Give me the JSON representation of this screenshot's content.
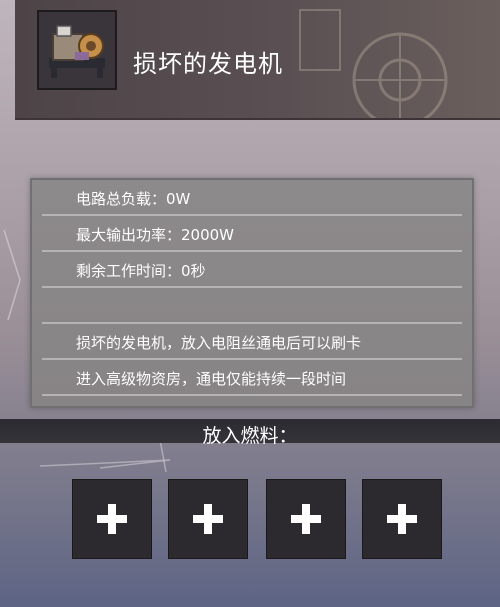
{
  "generator": {
    "name": "损坏的发电机",
    "icon": "generator-icon"
  },
  "info": {
    "rows": [
      {
        "text": "电路总负载：0W"
      },
      {
        "text": "最大输出功率：2000W"
      },
      {
        "text": "剩余工作时间：0秒"
      },
      {
        "text": ""
      },
      {
        "text": "损坏的发电机，放入电阻丝通电后可以刷卡"
      },
      {
        "text": "进入高级物资房，通电仅能持续一段时间"
      }
    ]
  },
  "fuel": {
    "title": "放入燃料：",
    "slots": [
      {
        "icon": "plus-icon"
      },
      {
        "icon": "plus-icon"
      },
      {
        "icon": "plus-icon"
      },
      {
        "icon": "plus-icon"
      }
    ]
  }
}
